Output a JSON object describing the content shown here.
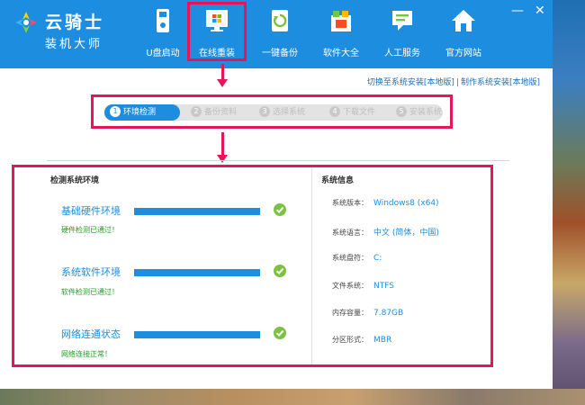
{
  "app": {
    "title": "云骑士",
    "subtitle": "装机大师"
  },
  "nav": [
    {
      "label": "U盘启动",
      "icon": "usb-drive-icon"
    },
    {
      "label": "在线重装",
      "icon": "windows-monitor-icon"
    },
    {
      "label": "一键备份",
      "icon": "backup-sync-icon"
    },
    {
      "label": "软件大全",
      "icon": "software-box-icon"
    },
    {
      "label": "人工服务",
      "icon": "chat-service-icon"
    },
    {
      "label": "官方网站",
      "icon": "home-website-icon"
    }
  ],
  "window_controls": {
    "minimize": "—",
    "close": "✕"
  },
  "links": {
    "switch_label": "切换至系统安装[本地版]",
    "separator": "|",
    "make_label": "制作系统安装[本地版]"
  },
  "steps": [
    {
      "num": "1",
      "label": "环境检测"
    },
    {
      "num": "2",
      "label": "备份资料"
    },
    {
      "num": "3",
      "label": "选择系统"
    },
    {
      "num": "4",
      "label": "下载文件"
    },
    {
      "num": "5",
      "label": "安装系统"
    }
  ],
  "detect": {
    "title": "检测系统环境",
    "items": [
      {
        "title": "基础硬件环境",
        "status": "硬件检测已通过！",
        "progress": 1.0
      },
      {
        "title": "系统软件环境",
        "status": "软件检测已通过！",
        "progress": 1.0
      },
      {
        "title": "网络连通状态",
        "status": "网络连接正常！",
        "progress": 1.0
      }
    ]
  },
  "sysinfo": {
    "title": "系统信息",
    "rows": [
      {
        "key": "系统版本：",
        "value": "Windows8 (x64)"
      },
      {
        "key": "系统语言：",
        "value": "中文 (简体，中国)"
      },
      {
        "key": "系统盘符：",
        "value": "C:"
      },
      {
        "key": "文件系统：",
        "value": "NTFS"
      },
      {
        "key": "内存容量：",
        "value": "7.87GB"
      },
      {
        "key": "分区形式：",
        "value": "MBR"
      }
    ]
  },
  "colors": {
    "brand": "#1d8de0",
    "highlight": "#e8145a",
    "ok": "#7bc242",
    "pass_text": "#1fa01f"
  }
}
